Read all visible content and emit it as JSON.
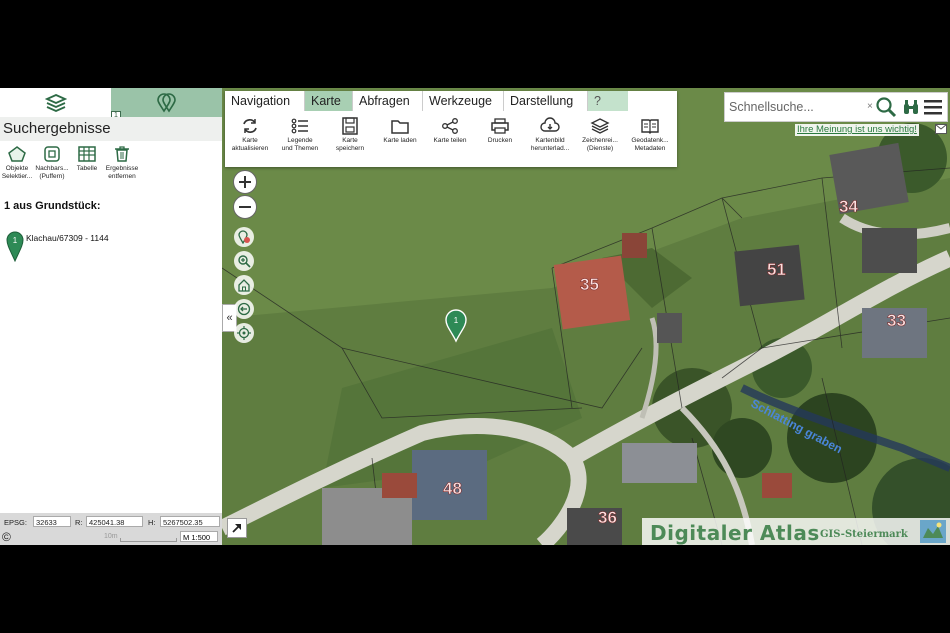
{
  "sidebar": {
    "tab_badge": "1",
    "title": "Suchergebnisse",
    "tools": [
      {
        "icon": "pentagon-select-icon",
        "label_1": "Objekte",
        "label_2": "Selektier..."
      },
      {
        "icon": "buffer-icon",
        "label_1": "Nachbars...",
        "label_2": "(Puffern)"
      },
      {
        "icon": "table-icon",
        "label_1": "Tabelle",
        "label_2": ""
      },
      {
        "icon": "trash-icon",
        "label_1": "Ergebnisse",
        "label_2": "entfernen"
      }
    ],
    "result_heading": "1 aus Grundstück:",
    "results": [
      {
        "marker": "1",
        "label": "Klachau/67309 - 1144"
      }
    ]
  },
  "statusbar": {
    "epsg_label": "EPSG:",
    "epsg_value": "32633",
    "r_label": "R:",
    "r_value": "425041.38",
    "h_label": "H:",
    "h_value": "5267502.35",
    "copyright": "©",
    "scale_text": "10m",
    "scale_value": "M 1:500"
  },
  "menu": {
    "tabs": [
      "Navigation",
      "Karte",
      "Abfragen",
      "Werkzeuge",
      "Darstellung",
      "?"
    ],
    "active_tab": "Karte",
    "tools": [
      {
        "icon": "refresh-icon",
        "label_1": "Karte",
        "label_2": "aktualisieren"
      },
      {
        "icon": "legend-icon",
        "label_1": "Legende",
        "label_2": "und Themen"
      },
      {
        "icon": "save-icon",
        "label_1": "Karte",
        "label_2": "speichern"
      },
      {
        "icon": "folder-icon",
        "label_1": "Karte laden",
        "label_2": ""
      },
      {
        "icon": "share-icon",
        "label_1": "Karte teilen",
        "label_2": ""
      },
      {
        "icon": "print-icon",
        "label_1": "Drucken",
        "label_2": ""
      },
      {
        "icon": "download-cloud-icon",
        "label_1": "Kartenbild",
        "label_2": "herunterlad..."
      },
      {
        "icon": "layers-icon",
        "label_1": "Zeichenrei...",
        "label_2": "(Dienste)"
      },
      {
        "icon": "book-icon",
        "label_1": "Geodatenk...",
        "label_2": "Metadaten"
      }
    ]
  },
  "search": {
    "placeholder": "Schnellsuche...",
    "clear": "×"
  },
  "feedback_link": "Ihre Meinung ist uns wichtig!",
  "map": {
    "marker_label": "1",
    "house_numbers": [
      "35",
      "34",
      "51",
      "33",
      "48",
      "36"
    ],
    "stream_label": "Schlatting graben"
  },
  "watermark": {
    "title": "Digitaler Atlas",
    "subtitle": "GIS-Steiermark"
  },
  "colors": {
    "accent": "#9ac3a8",
    "active_tab": "#a8cfb3",
    "marker": "#2e8a56",
    "brand_green": "#4d8a58"
  }
}
